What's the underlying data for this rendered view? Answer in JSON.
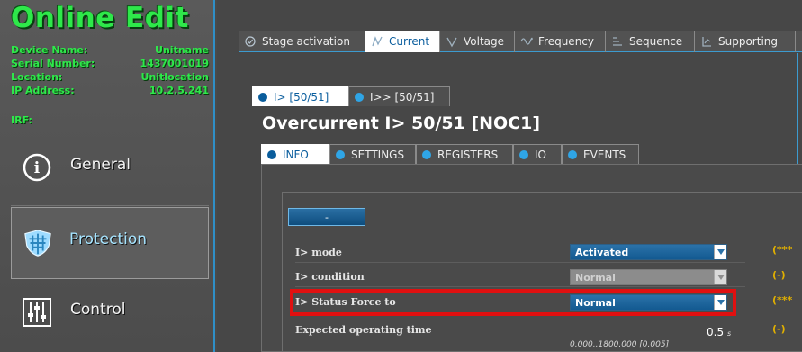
{
  "device": {
    "title": "Online Edit",
    "info": [
      {
        "key": "Device Name:",
        "value": "Unitname"
      },
      {
        "key": "Serial Number:",
        "value": "1437001019"
      },
      {
        "key": "Location:",
        "value": "Unitlocation"
      },
      {
        "key": "IP Address:",
        "value": "10.2.5.241"
      }
    ],
    "irf_label": "IRF:"
  },
  "sidebar": {
    "items": [
      {
        "label": "General",
        "icon": "info-icon"
      },
      {
        "label": "Protection",
        "icon": "shield-icon",
        "selected": true
      },
      {
        "label": "Control",
        "icon": "sliders-icon"
      }
    ]
  },
  "top_tabs": [
    {
      "label": "Stage activation",
      "icon": "check-icon"
    },
    {
      "label": "Current",
      "icon": "current-icon",
      "active": true
    },
    {
      "label": "Voltage",
      "icon": "voltage-icon"
    },
    {
      "label": "Frequency",
      "icon": "frequency-icon"
    },
    {
      "label": "Sequence",
      "icon": "sequence-icon"
    },
    {
      "label": "Supporting",
      "icon": "supporting-icon"
    }
  ],
  "stage_tabs": [
    {
      "label": "I> [50/51]",
      "active": true
    },
    {
      "label": "I>> [50/51]"
    }
  ],
  "page_title": "Overcurrent I> 50/51 [NOC1]",
  "section_tabs": [
    {
      "label": "INFO",
      "active": true
    },
    {
      "label": "SETTINGS"
    },
    {
      "label": "REGISTERS"
    },
    {
      "label": "IO"
    },
    {
      "label": "EVENTS"
    }
  ],
  "dash_button": "-",
  "rows": [
    {
      "label": "I> mode",
      "value": "Activated",
      "state": "enabled",
      "unit": "(***"
    },
    {
      "label": "I> condition",
      "value": "Normal",
      "state": "disabled",
      "unit": "(-)"
    },
    {
      "label": "I> Status Force to",
      "value": "Normal",
      "state": "enabled",
      "unit": "(***",
      "highlighted": true
    },
    {
      "label": "Expected operating time",
      "value": "0.5",
      "value_unit": "s",
      "range": "0.000..1800.000 [0.005]",
      "unit": "(-)"
    }
  ],
  "colors": {
    "accent_green": "#2ee84a",
    "accent_blue": "#2f8fc7",
    "highlight_red": "#e01010",
    "unit_gold": "#e1b000"
  }
}
